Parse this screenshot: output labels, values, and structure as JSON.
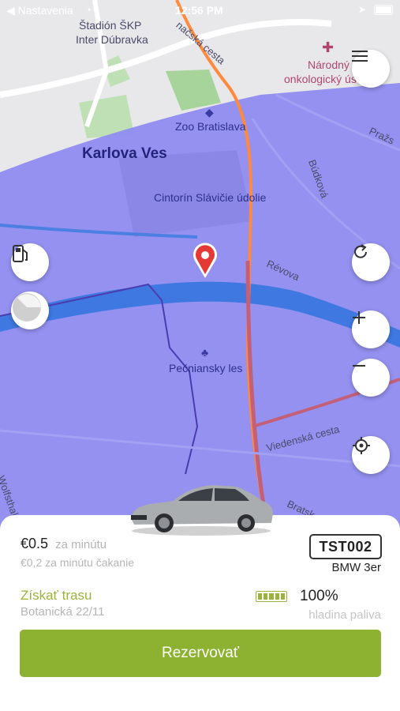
{
  "status_bar": {
    "back_label": "◀ Nastavenia",
    "time": "12:56 PM"
  },
  "map": {
    "labels": {
      "stadium": "Štadión ŠKP",
      "stadium2": "Inter Dúbravka",
      "cancer_inst": "Národný",
      "cancer_inst2": "onkologický ús",
      "zoo": "Zoo Bratislava",
      "karlova": "Karlova Ves",
      "cemetery": "Cintorín Slávičie údolie",
      "forest": "Pečniansky les",
      "revova": "Révova",
      "budkova": "Búdková",
      "prazska": "Pražs",
      "viedenska": "Viedenská cesta",
      "bratska": "Bratsk",
      "wolfsthal": "Wolfsthal",
      "cesta_top": "načská cesta"
    }
  },
  "colors": {
    "accent": "#8db231",
    "zone": "#8f8cf0",
    "pin": "#e53935",
    "river": "#3f78e0"
  },
  "icons": [
    "menu-icon",
    "fuel-station-icon",
    "speed-gauge-icon",
    "refresh-icon",
    "zoom-in-icon",
    "zoom-out-icon",
    "locate-icon",
    "map-pin-icon"
  ],
  "car": {
    "price": "€0.5",
    "price_unit": "za minútu",
    "wait_price": "€0,2 za minútu čakanie",
    "plate": "TST002",
    "model": "BMW 3er",
    "route_link": "Získať trasu",
    "address": "Botanická 22/11",
    "fuel_percent": "100%",
    "fuel_label": "hladina paliva",
    "fuel_level": 1.0
  },
  "reserve_button": "Rezervovať"
}
